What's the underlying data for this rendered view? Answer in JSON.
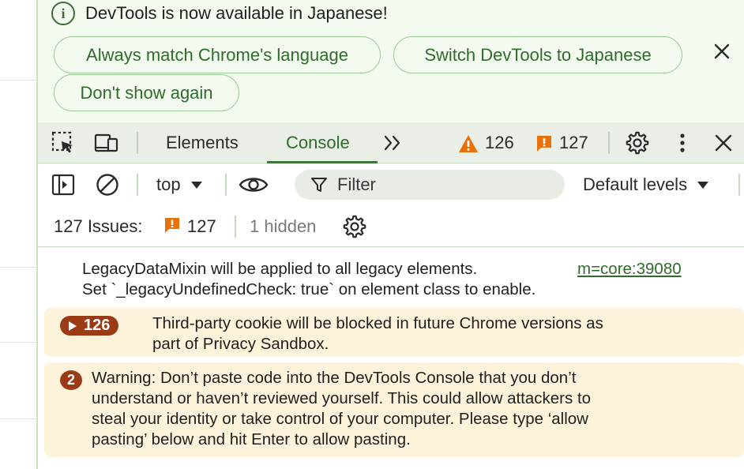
{
  "infobar": {
    "title": "DevTools is now available in Japanese!",
    "buttons": {
      "match_language": "Always match Chrome's language",
      "switch_language": "Switch DevTools to Japanese",
      "dont_show": "Don't show again"
    }
  },
  "tabs": {
    "items": [
      {
        "label": "Elements",
        "active": false
      },
      {
        "label": "Console",
        "active": true
      }
    ],
    "warning_count": "126",
    "issue_count": "127"
  },
  "console_toolbar": {
    "context": "top",
    "filter_placeholder": "Filter",
    "levels": "Default levels"
  },
  "issues_bar": {
    "label": "127 Issues:",
    "count": "127",
    "hidden": "1 hidden"
  },
  "messages": [
    {
      "type": "log",
      "lines": [
        "LegacyDataMixin will be applied to all legacy elements.",
        "Set `_legacyUndefinedCheck: true` on element class to enable."
      ],
      "source": "m=core:39080"
    },
    {
      "type": "warning-group",
      "badge": "126",
      "lines": [
        "Third-party cookie will be blocked in future Chrome versions as",
        "part of Privacy Sandbox."
      ]
    },
    {
      "type": "warning",
      "badge": "2",
      "lines": [
        "Warning: Don’t paste code into the DevTools Console that you don’t",
        "understand or haven’t reviewed yourself. This could allow attackers to",
        "steal your identity or take control of your computer. Please type ‘allow",
        "pasting’ below and hit Enter to allow pasting."
      ]
    }
  ],
  "colors": {
    "accent_green": "#2f6b2b",
    "warning_orange": "#e8710a",
    "issue_orange": "#e8710a",
    "warning_bg": "#fcf3da",
    "badge_brown": "#9a3b16"
  }
}
